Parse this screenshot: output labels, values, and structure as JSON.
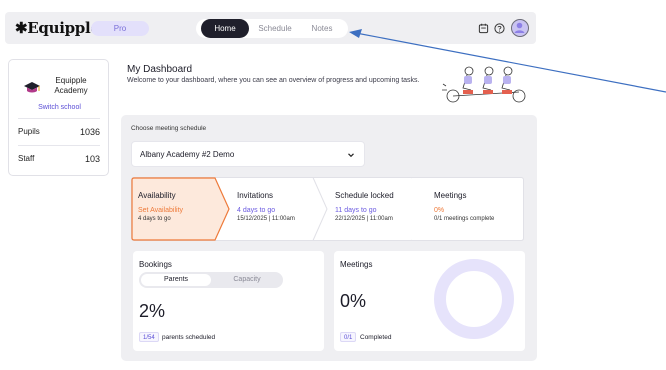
{
  "header": {
    "logo": "Equipple",
    "logo_mark": "®",
    "plan_badge": "Pro",
    "nav": [
      {
        "label": "Home",
        "active": true
      },
      {
        "label": "Schedule",
        "active": false
      },
      {
        "label": "Notes",
        "active": false
      }
    ],
    "icons": [
      "calendar-icon",
      "help-icon",
      "avatar-icon"
    ]
  },
  "sidebar": {
    "school_name": "Equipple Academy",
    "switch_label": "Switch school",
    "stats": [
      {
        "label": "Pupils",
        "value": "1036"
      },
      {
        "label": "Staff",
        "value": "103"
      }
    ]
  },
  "dashboard": {
    "title": "My Dashboard",
    "subtitle": "Welcome to your dashboard, where you can see an overview of progress and upcoming tasks."
  },
  "schedule": {
    "choose_label": "Choose meeting schedule",
    "selected": "Albany Academy #2 Demo"
  },
  "steps": [
    {
      "label": "Availability",
      "status": "Set Availability",
      "detail": "4 days to go",
      "active": true
    },
    {
      "label": "Invitations",
      "status": "4 days to go",
      "detail": "15/12/2025 | 11:00am",
      "active": false
    },
    {
      "label": "Schedule locked",
      "status": "11 days to go",
      "detail": "22/12/2025 | 11:00am",
      "active": false
    },
    {
      "label": "Meetings",
      "status": "0%",
      "detail": "0/1 meetings complete",
      "active": false
    }
  ],
  "bookings": {
    "title": "Bookings",
    "segments": [
      {
        "label": "Parents",
        "active": true
      },
      {
        "label": "Capacity",
        "active": false
      }
    ],
    "percent": "2%",
    "badge": "1/54",
    "footer": "parents scheduled"
  },
  "meetings": {
    "title": "Meetings",
    "percent": "0%",
    "badge": "0/1",
    "footer": "Completed",
    "progress": 0
  },
  "colors": {
    "accent": "#6a5ae0",
    "active_step_bg": "#fde9dc",
    "active_step_border": "#ee7a3a",
    "donut_track": "#e6e3fb",
    "arrow": "#3d6fc1"
  }
}
